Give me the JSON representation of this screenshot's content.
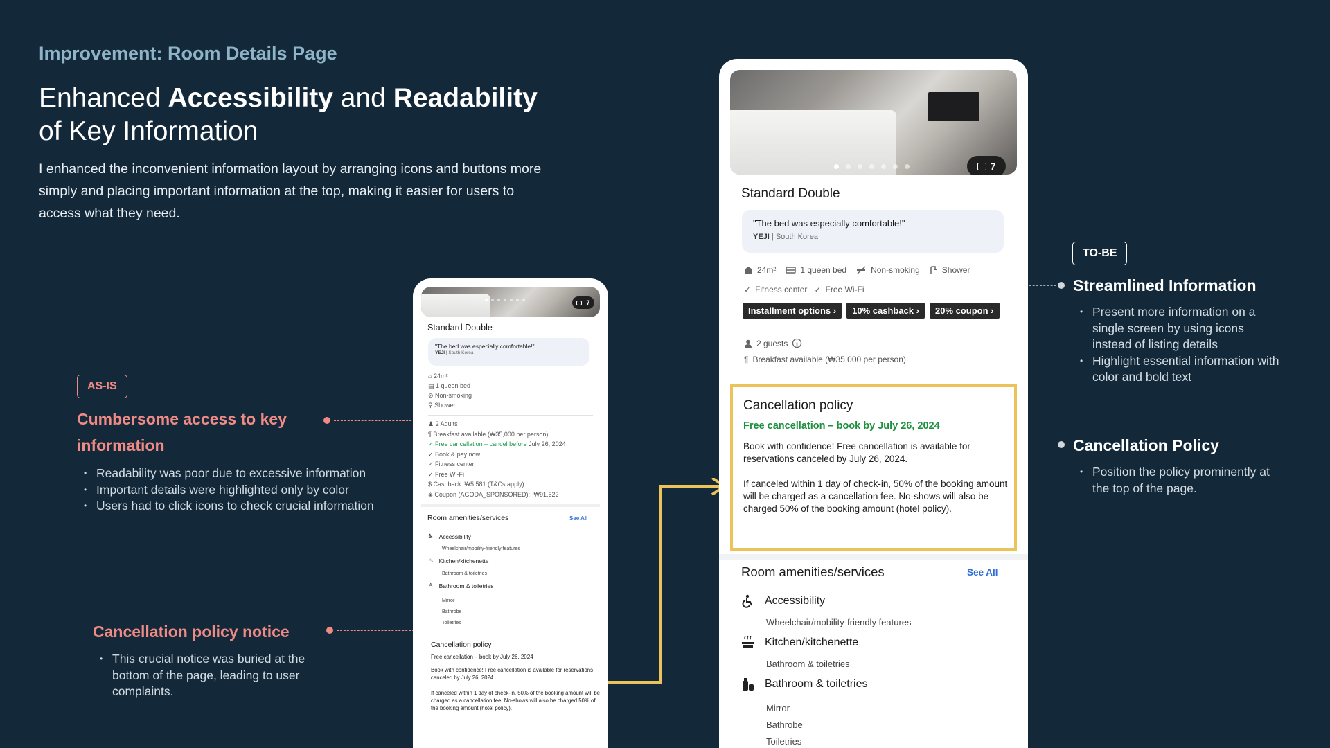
{
  "header": {
    "eyebrow": "Improvement: Room Details Page",
    "headline_1": "Enhanced ",
    "headline_b1": "Accessibility",
    "headline_2": " and ",
    "headline_b2": "Readability",
    "headline_3": " of Key Information",
    "intro": "I enhanced the inconvenient information layout by arranging icons and buttons more simply and placing important information at the top, making it easier for users to access what they need."
  },
  "as_is": {
    "tag": "AS-IS",
    "note1_title": "Cumbersome access to key information",
    "note1_bullets": [
      "Readability was poor due to excessive information",
      "Important details were highlighted only by color",
      "Users had to click icons to check crucial information"
    ],
    "note2_title": "Cancellation policy notice",
    "note2_bullets": [
      "This crucial notice was buried at the bottom of the page, leading to user complaints."
    ]
  },
  "to_be": {
    "tag": "TO-BE",
    "note1_title": "Streamlined Information",
    "note1_bullets": [
      "Present more information on a single screen by using icons instead of listing details",
      "Highlight essential information with color and bold text"
    ],
    "note2_title": "Cancellation Policy",
    "note2_bullets": [
      "Position the policy prominently at the top of the page."
    ]
  },
  "phone_old": {
    "photo_count": "7",
    "room_title": "Standard Double",
    "review_quote": "\"The bed was especially comfortable!\"",
    "review_name": "YEJI",
    "review_country": " | South Korea",
    "specs": [
      "24m²",
      "1 queen bed",
      "Non-smoking",
      "Shower"
    ],
    "details": [
      "2 Adults",
      "Breakfast available (₩35,000 per person)",
      "Free cancellation – cancel before",
      "Book & pay now",
      "Fitness center",
      "Free Wi-Fi",
      "Cashback: ₩5,581 (T&Cs apply)",
      "Coupon (AGODA_SPONSORED): -₩91,622"
    ],
    "cancel_date": " July 26, 2024",
    "amen_title": "Room amenities/services",
    "see_all": "See All",
    "amen": [
      {
        "name": "Accessibility",
        "sub": [
          "Wheelchair/mobility-friendly features"
        ]
      },
      {
        "name": "Kitchen/kitchenette",
        "sub": [
          "Bathroom & toiletries"
        ]
      },
      {
        "name": "Bathroom & toiletries",
        "sub": [
          "Mirror",
          "Bathrobe",
          "Toiletries"
        ]
      }
    ],
    "policy_title": "Cancellation policy",
    "policy_green": "Free cancellation – book by July 26, 2024",
    "policy_p1": "Book with confidence! Free cancellation is available for reservations canceled by July 26, 2024.",
    "policy_p2": "If canceled within 1 day of check-in, 50% of the booking amount will be charged as a cancellation fee. No-shows will also be charged 50% of the booking amount (hotel policy)."
  },
  "phone_new": {
    "photo_count": "7",
    "room_title": "Standard Double",
    "review_quote": "\"The bed was especially comfortable!\"",
    "review_name": "YEJI",
    "review_country": " | South Korea",
    "spec_size": "24m²",
    "spec_bed": "1 queen bed",
    "spec_smoke": "Non-smoking",
    "spec_shower": "Shower",
    "feat_fitness": "Fitness center",
    "feat_wifi": "Free Wi-Fi",
    "chips": [
      "Installment options",
      "10% cashback",
      "20% coupon"
    ],
    "guests": "2 guests",
    "breakfast": "Breakfast available (₩35,000 per person)",
    "policy_title": "Cancellation policy",
    "policy_green": "Free cancellation – book by July 26, 2024",
    "policy_p1": "Book with confidence! Free cancellation is available for reservations canceled by July 26, 2024.",
    "policy_p2": "If canceled within 1 day of check-in, 50% of the booking amount will be charged as a cancellation fee. No-shows will also be charged 50% of the booking amount (hotel policy).",
    "amen_title": "Room amenities/services",
    "see_all": "See All",
    "amen1": "Accessibility",
    "amen1_sub": "Wheelchair/mobility-friendly features",
    "amen2": "Kitchen/kitchenette",
    "amen2_sub": "Bathroom & toiletries",
    "amen3": "Bathroom & toiletries",
    "amen3_sub": [
      "Mirror",
      "Bathrobe",
      "Toiletries"
    ]
  },
  "colors": {
    "background": "#13293a",
    "as_is_accent": "#f08a85",
    "highlight_box": "#ecc25a",
    "free_cancel_green": "#1d8f3e",
    "link_blue": "#2f6fd1"
  }
}
